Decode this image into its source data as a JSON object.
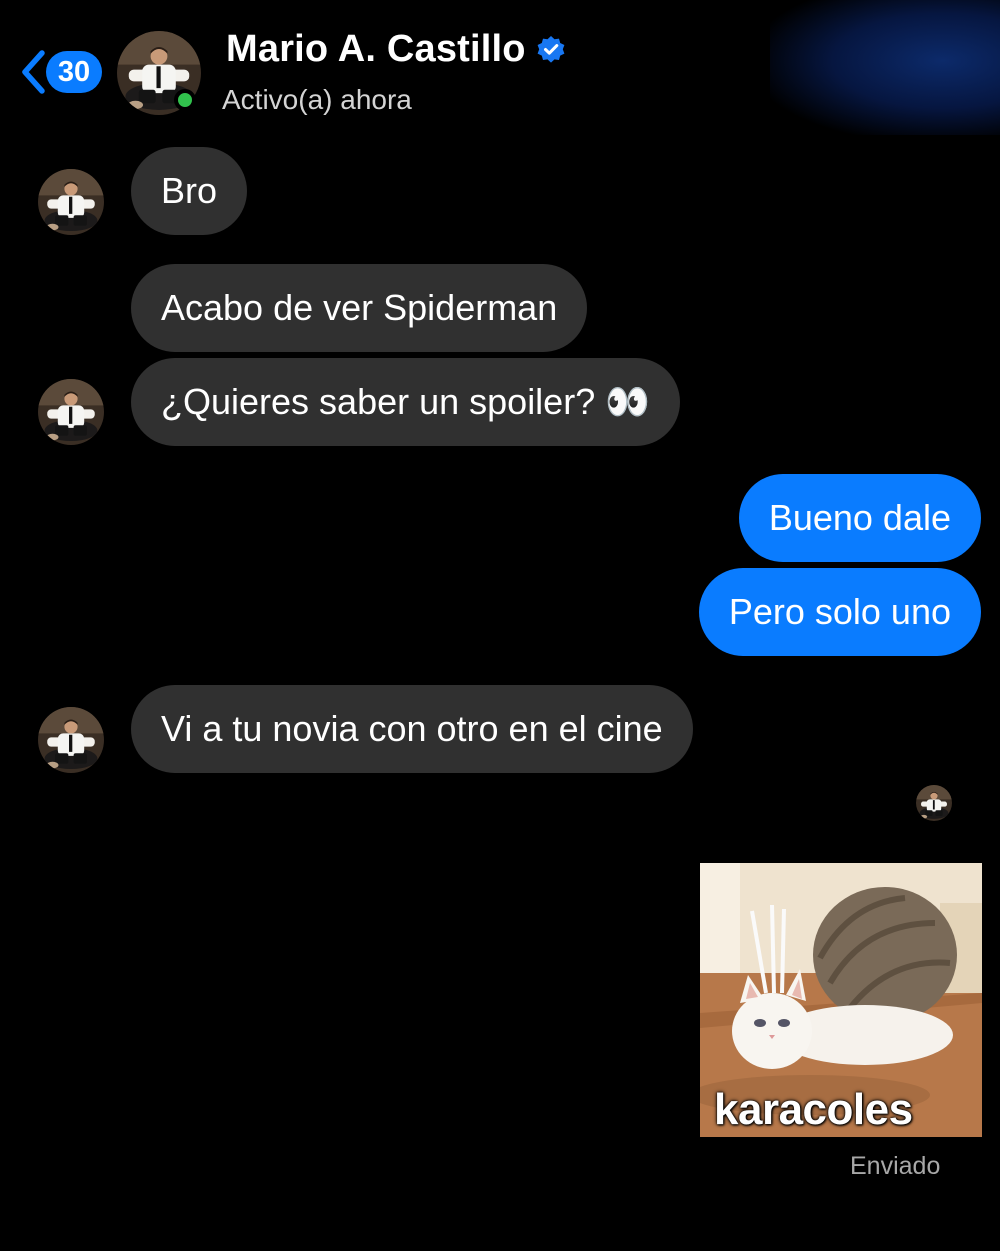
{
  "header": {
    "back_count": "30",
    "contact_name": "Mario A. Castillo",
    "status": "Activo(a) ahora",
    "verified": true,
    "online": true
  },
  "messages": [
    {
      "direction": "incoming",
      "text": "Bro",
      "show_avatar": true
    },
    {
      "direction": "incoming",
      "text": "Acabo de ver Spiderman",
      "show_avatar": false
    },
    {
      "direction": "incoming",
      "text": "¿Quieres saber un spoiler? 👀",
      "show_avatar": true
    },
    {
      "direction": "outgoing",
      "text": "Bueno dale"
    },
    {
      "direction": "outgoing",
      "text": "Pero solo uno"
    },
    {
      "direction": "incoming",
      "text": "Vi a tu novia con otro en el cine",
      "show_avatar": true
    }
  ],
  "attachment": {
    "direction": "outgoing",
    "type": "sticker-image",
    "caption": "karacoles"
  },
  "sent_status": "Enviado",
  "colors": {
    "background": "#000000",
    "incoming_bubble": "#303030",
    "outgoing_bubble": "#0a7cff",
    "online_dot": "#31c24d",
    "verified": "#1877f2"
  }
}
